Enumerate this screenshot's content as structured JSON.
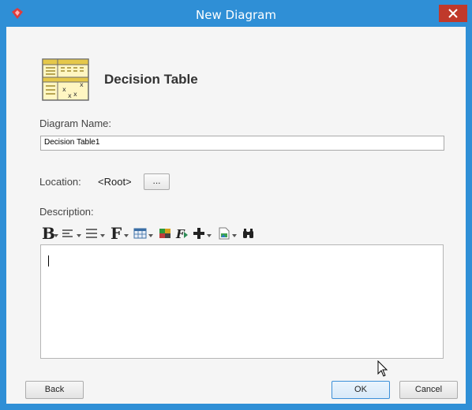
{
  "window": {
    "title": "New Diagram"
  },
  "header": {
    "title": "Decision Table"
  },
  "form": {
    "name_label": "Diagram Name:",
    "name_value": "Decision Table1",
    "location_label": "Location:",
    "location_value": "<Root>",
    "browse_label": "...",
    "description_label": "Description:"
  },
  "toolbar": {
    "bold_label": "B",
    "font_label": "F",
    "items": [
      "bold",
      "align",
      "list",
      "font",
      "table",
      "color",
      "format",
      "insert",
      "insert-image",
      "find"
    ]
  },
  "buttons": {
    "back_label": "Back",
    "ok_label": "OK",
    "cancel_label": "Cancel"
  },
  "colors": {
    "titlebar": "#2f8fd6",
    "close": "#c0392b",
    "brand_icon": "#d94040"
  }
}
